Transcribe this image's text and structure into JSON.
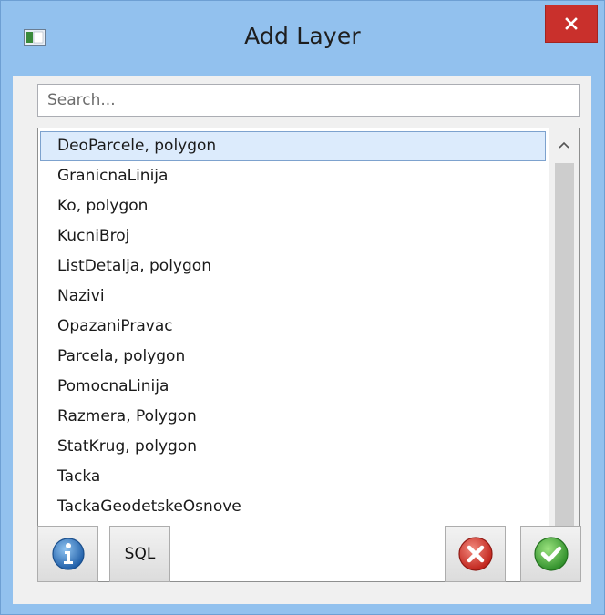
{
  "window": {
    "title": "Add Layer"
  },
  "search": {
    "placeholder": "Search...",
    "value": ""
  },
  "layers": {
    "items": [
      "DeoParcele, polygon",
      "GranicnaLinija",
      "Ko, polygon",
      "KucniBroj",
      "ListDetalja, polygon",
      "Nazivi",
      "OpazaniPravac",
      "Parcela, polygon",
      "PomocnaLinija",
      "Razmera, Polygon",
      "StatKrug, polygon",
      "Tacka",
      "TackaGeodetskeOsnove"
    ],
    "selected_index": 0
  },
  "buttons": {
    "info_icon": "info-icon",
    "sql_label": "SQL",
    "cancel_icon": "cancel-icon",
    "ok_icon": "ok-icon"
  },
  "colors": {
    "window_frame": "#92c1ee",
    "close_button": "#c9302c",
    "selection": "#dcebfc",
    "cancel_red": "#d9342b",
    "ok_green": "#3aa53a",
    "info_blue": "#2a6db3"
  }
}
